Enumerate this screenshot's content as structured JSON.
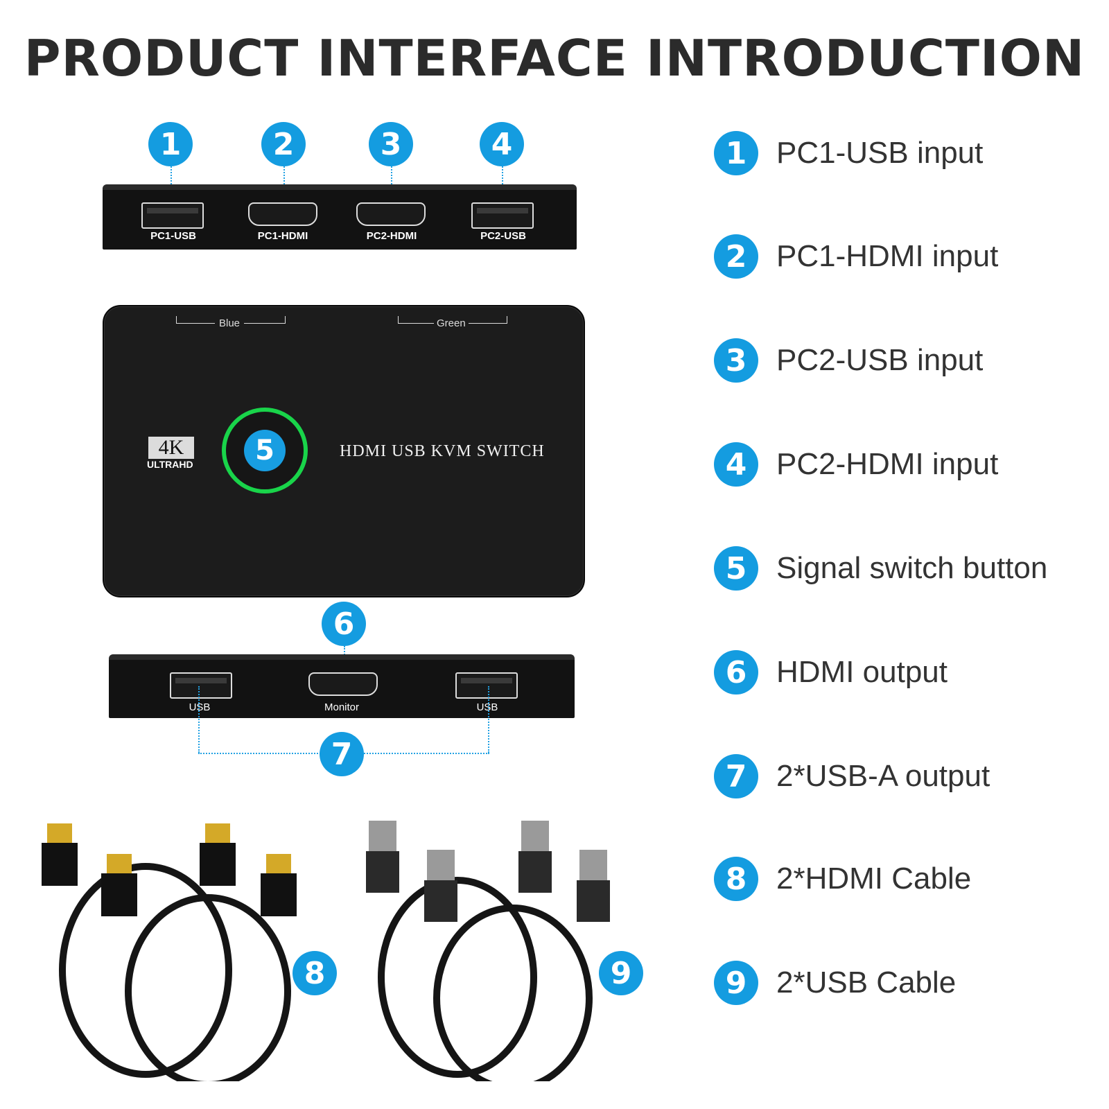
{
  "title": "PRODUCT INTERFACE INTRODUCTION",
  "colors": {
    "badge": "#149ce0",
    "ring": "#19d44a",
    "text": "#333333",
    "device": "#1c1c1c"
  },
  "back_panel": {
    "ports": [
      {
        "num": "1",
        "label": "PC1-USB",
        "type": "usb"
      },
      {
        "num": "2",
        "label": "PC1-HDMI",
        "type": "hdmi"
      },
      {
        "num": "3",
        "label": "PC2-HDMI",
        "type": "hdmi"
      },
      {
        "num": "4",
        "label": "PC2-USB",
        "type": "usb"
      }
    ]
  },
  "device": {
    "led_blue": "Blue",
    "led_green": "Green",
    "badge_4k": "4K",
    "badge_ultrahd": "ULTRAHD",
    "button_num": "5",
    "name": "HDMI USB KVM SWITCH"
  },
  "front_panel": {
    "ports": [
      {
        "label": "USB",
        "type": "usb"
      },
      {
        "label": "Monitor",
        "type": "hdmi"
      },
      {
        "label": "USB",
        "type": "usb"
      }
    ],
    "hdmi_num": "6",
    "usb_num": "7"
  },
  "cables": {
    "hdmi_num": "8",
    "usb_num": "9"
  },
  "legend": [
    {
      "num": "1",
      "text": "PC1-USB input"
    },
    {
      "num": "2",
      "text": "PC1-HDMI input"
    },
    {
      "num": "3",
      "text": "PC2-USB input"
    },
    {
      "num": "4",
      "text": "PC2-HDMI input"
    },
    {
      "num": "5",
      "text": "Signal switch button"
    },
    {
      "num": "6",
      "text": "HDMI output"
    },
    {
      "num": "7",
      "text": "2*USB-A output"
    },
    {
      "num": "8",
      "text": "2*HDMI Cable"
    },
    {
      "num": "9",
      "text": "2*USB Cable"
    }
  ]
}
